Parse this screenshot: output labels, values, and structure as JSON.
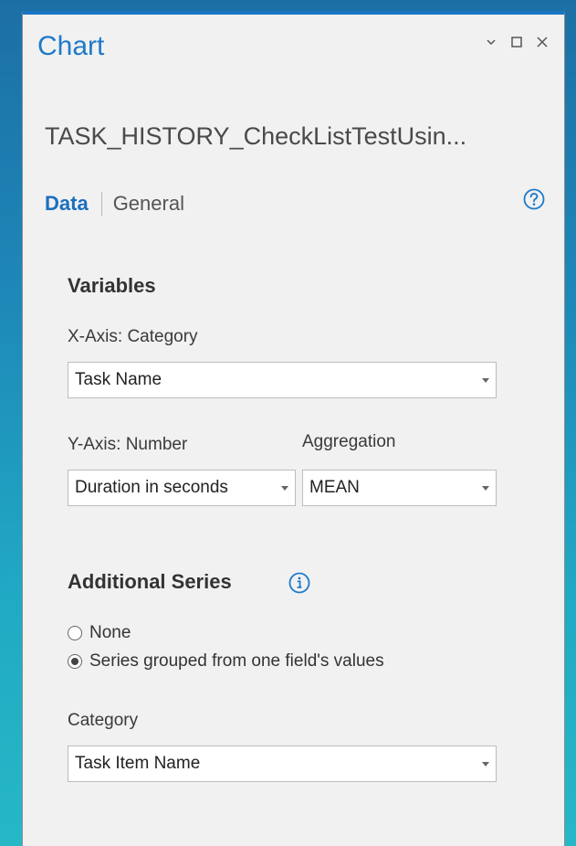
{
  "pane": {
    "title": "Chart",
    "layer_name": "TASK_HISTORY_CheckListTestUsin...",
    "tabs": {
      "data": "Data",
      "general": "General"
    }
  },
  "variables": {
    "heading": "Variables",
    "x_axis_label": "X-Axis: Category",
    "x_axis_value": "Task Name",
    "y_axis_label": "Y-Axis: Number",
    "y_axis_value": "Duration in seconds",
    "aggregation_label": "Aggregation",
    "aggregation_value": "MEAN"
  },
  "additional_series": {
    "heading": "Additional Series",
    "options": [
      "None",
      "Series grouped from one field's values"
    ],
    "selected_index": 1,
    "category_label": "Category",
    "category_value": "Task Item Name"
  },
  "colors": {
    "accent": "#1e7ac9",
    "pane_background": "#f1f1f1"
  }
}
